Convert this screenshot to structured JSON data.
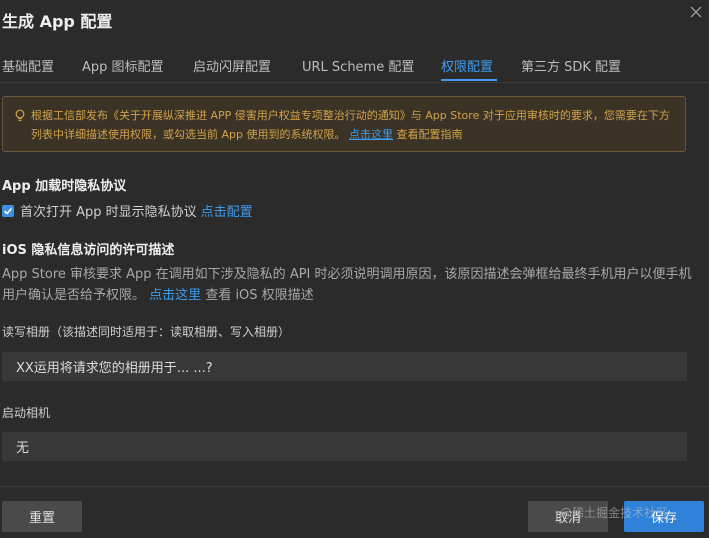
{
  "dialog": {
    "title": "生成 App 配置",
    "close_icon": "close-icon"
  },
  "tabs": [
    {
      "label": "基础配置",
      "active": false
    },
    {
      "label": "App 图标配置",
      "active": false
    },
    {
      "label": "启动闪屏配置",
      "active": false
    },
    {
      "label": "URL Scheme 配置",
      "active": false
    },
    {
      "label": "权限配置",
      "active": true
    },
    {
      "label": "第三方 SDK 配置",
      "active": false
    }
  ],
  "notice": {
    "icon": "lightbulb-icon",
    "text": "根据工信部发布《关于开展纵深推进 APP 侵害用户权益专项整治行动的通知》与 App Store 对于应用审核时的要求，您需要在下方列表中详细描述使用权限，或勾选当前 App 使用到的系统权限。",
    "link_text": "点击这里",
    "after_link": "查看配置指南",
    "color": "#d2a24a"
  },
  "privacy": {
    "section_title": "App 加载时隐私协议",
    "checkbox_label": "首次打开 App 时显示隐私协议",
    "checkbox_checked": true,
    "config_link": "点击配置"
  },
  "ios": {
    "section_title": "iOS 隐私信息访问的许可描述",
    "description": "App Store 审核要求 App 在调用如下涉及隐私的 API 时必须说明调用原因，该原因描述会弹框给最终手机用户以便手机用户确认是否给予权限。",
    "link_text": "点击这里",
    "after_link": "查看 iOS 权限描述"
  },
  "fields": {
    "photos": {
      "label": "读写相册（该描述同时适用于：读取相册、写入相册）",
      "value": "XX运用将请求您的相册用于... ...?"
    },
    "camera": {
      "label": "启动相机",
      "value": "无"
    }
  },
  "footer": {
    "reset_label": "重置",
    "cancel_label": "取消",
    "save_label": "保存",
    "watermark": "@稀土掘金技术社区"
  },
  "colors": {
    "accent": "#3d9cf0",
    "primary_button": "#2f82d8",
    "background": "#2b2b2b"
  }
}
